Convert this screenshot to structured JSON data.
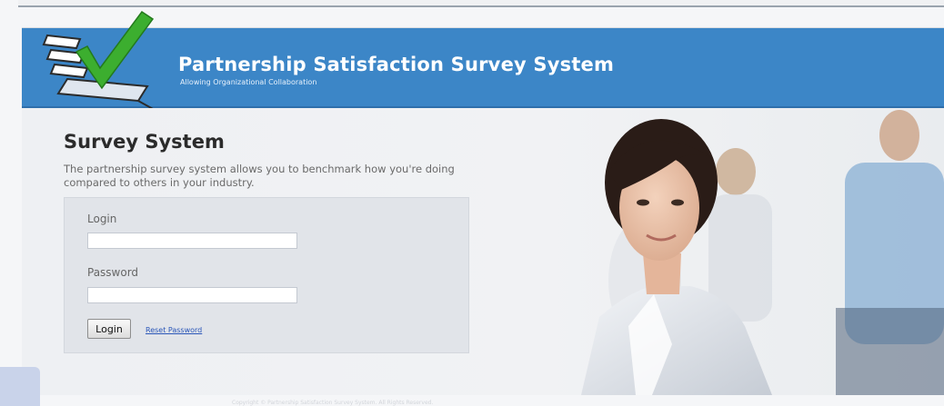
{
  "header": {
    "title": "Partnership Satisfaction Survey System",
    "subtitle": "Allowing Organizational Collaboration"
  },
  "main": {
    "heading": "Survey System",
    "description": "The partnership survey system allows you to benchmark how you're doing compared to others in your industry."
  },
  "login_form": {
    "login_label": "Login",
    "login_value": "",
    "password_label": "Password",
    "password_value": "",
    "login_button": "Login",
    "reset_link": "Reset Password"
  },
  "footer": {
    "text": "Copyright © Partnership Satisfaction Survey System. All Rights Reserved."
  },
  "colors": {
    "banner": "#3c86c7",
    "link": "#2a56b8",
    "checkmark": "#3cae2f"
  },
  "icons": {
    "logo": "checklist-checkmark-icon"
  }
}
